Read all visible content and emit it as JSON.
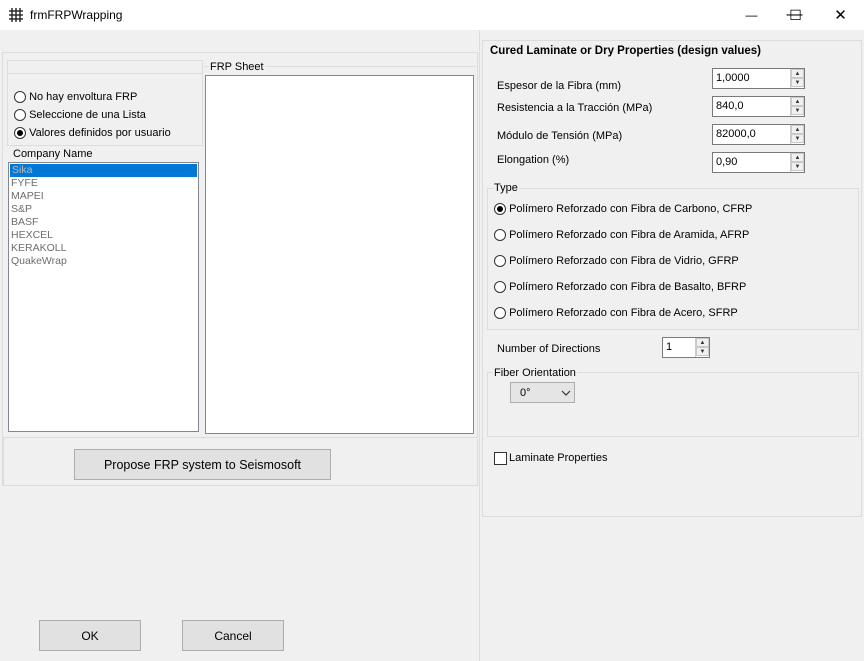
{
  "window": {
    "title": "frmFRPWrapping",
    "minimize": "—",
    "maximize": "☐",
    "close": "✕"
  },
  "wrap_options": [
    {
      "label": "No hay envoltura FRP",
      "selected": false
    },
    {
      "label": "Seleccione de una Lista",
      "selected": false
    },
    {
      "label": "Valores definidos por usuario",
      "selected": true
    }
  ],
  "company": {
    "label": "Company Name",
    "items": [
      "Sika",
      "FYFE",
      "MAPEI",
      "S&P",
      "BASF",
      "HEXCEL",
      "KERAKOLL",
      "QuakeWrap"
    ],
    "selected_index": 0
  },
  "frp_sheet": {
    "label": "FRP Sheet"
  },
  "propose_button": "Propose FRP system to Seismosoft",
  "ok_button": "OK",
  "cancel_button": "Cancel",
  "properties": {
    "title": "Cured Laminate or Dry Properties (design values)",
    "fields": [
      {
        "label": "Espesor de la Fibra (mm)",
        "value": "1,0000"
      },
      {
        "label": "Resistencia a la Tracción (MPa)",
        "value": "840,0"
      },
      {
        "label": "Módulo de Tensión (MPa)",
        "value": "82000,0"
      },
      {
        "label": "Elongation (%)",
        "value": "0,90"
      }
    ]
  },
  "type_group": {
    "label": "Type",
    "options": [
      {
        "label": "Polímero Reforzado con Fibra de Carbono, CFRP",
        "selected": true
      },
      {
        "label": "Polímero Reforzado con Fibra de Aramida, AFRP",
        "selected": false
      },
      {
        "label": "Polímero Reforzado con Fibra de Vidrio, GFRP",
        "selected": false
      },
      {
        "label": "Polímero Reforzado con Fibra de Basalto, BFRP",
        "selected": false
      },
      {
        "label": "Polímero Reforzado con Fibra de Acero, SFRP",
        "selected": false
      }
    ]
  },
  "directions": {
    "label": "Number of Directions",
    "value": "1"
  },
  "fiber_orientation": {
    "label": "Fiber Orientation",
    "value": "0°"
  },
  "laminate_properties": {
    "label": "Laminate Properties",
    "checked": false
  }
}
